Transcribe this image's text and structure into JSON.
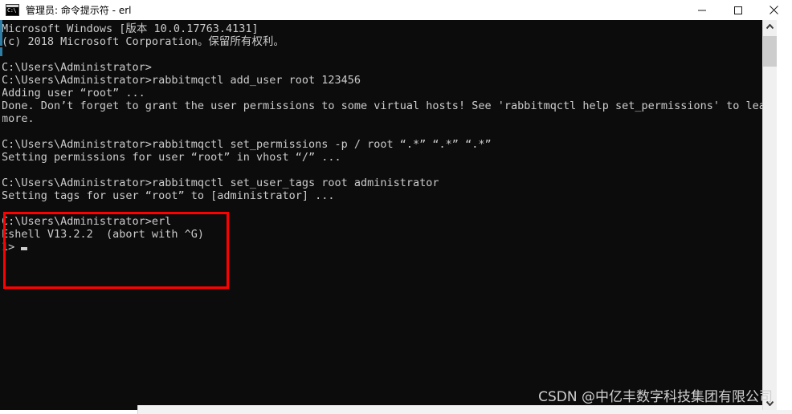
{
  "window": {
    "title": "管理员: 命令提示符 - erl",
    "icon": "cmd-icon",
    "icon_text": "C:\\",
    "controls": {
      "minimize_label": "Minimize",
      "maximize_label": "Maximize",
      "close_label": "Close"
    }
  },
  "terminal": {
    "background_color": "#0c0c0c",
    "foreground_color": "#cccccc",
    "lines": [
      "Microsoft Windows [版本 10.0.17763.4131]",
      "(c) 2018 Microsoft Corporation。保留所有权利。",
      "",
      "C:\\Users\\Administrator>",
      "C:\\Users\\Administrator>rabbitmqctl add_user root 123456",
      "Adding user “root” ...",
      "Done. Don’t forget to grant the user permissions to some virtual hosts! See 'rabbitmqctl help set_permissions' to learn",
      "more.",
      "",
      "C:\\Users\\Administrator>rabbitmqctl set_permissions -p / root “.*” “.*” “.*”",
      "Setting permissions for user “root” in vhost “/” ...",
      "",
      "C:\\Users\\Administrator>rabbitmqctl set_user_tags root administrator",
      "Setting tags for user “root” to [administrator] ...",
      "",
      "C:\\Users\\Administrator>erl",
      "Eshell V13.2.2  (abort with ^G)",
      "1> "
    ],
    "cursor_line_index": 17,
    "highlight": {
      "color": "#ff0000",
      "covers_lines": [
        15,
        16,
        17
      ]
    }
  },
  "scrollbar": {
    "up_arrow": "chevron-up-icon",
    "down_arrow": "chevron-down-icon",
    "thumb_label": "scroll-thumb"
  },
  "watermark": {
    "text": "CSDN @中亿丰数字科技集团有限公司"
  }
}
